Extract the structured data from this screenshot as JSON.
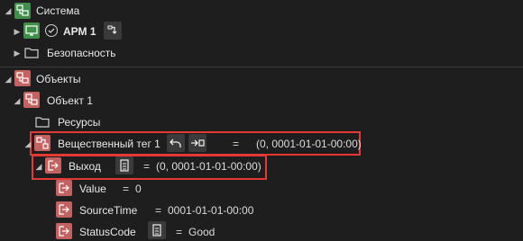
{
  "tree": {
    "system": {
      "label": "Система",
      "icon": "system-icon"
    },
    "arm": {
      "label": "АРМ 1",
      "icon": "workstation-icon"
    },
    "security": {
      "label": "Безопасность",
      "icon": "folder-icon"
    },
    "objects": {
      "label": "Объекты",
      "icon": "objects-icon"
    },
    "object1": {
      "label": "Объект 1",
      "icon": "object-icon"
    },
    "resources": {
      "label": "Ресурсы",
      "icon": "folder-icon"
    },
    "tag": {
      "label": "Вещественный тег 1",
      "eq": "=",
      "value": "(0, 0001-01-01-00:00)"
    },
    "output": {
      "label": "Выход",
      "eq": "=",
      "value": "(0, 0001-01-01-00:00)"
    },
    "props": [
      {
        "label": "Value",
        "eq": "=",
        "value": "0"
      },
      {
        "label": "SourceTime",
        "eq": "=",
        "value": "0001-01-01-00:00"
      },
      {
        "label": "StatusCode",
        "eq": "=",
        "value": "Good"
      }
    ]
  },
  "colors": {
    "highlight": "#e53935",
    "system_icon": "#3f8f4a",
    "object_icon": "#c46262"
  }
}
